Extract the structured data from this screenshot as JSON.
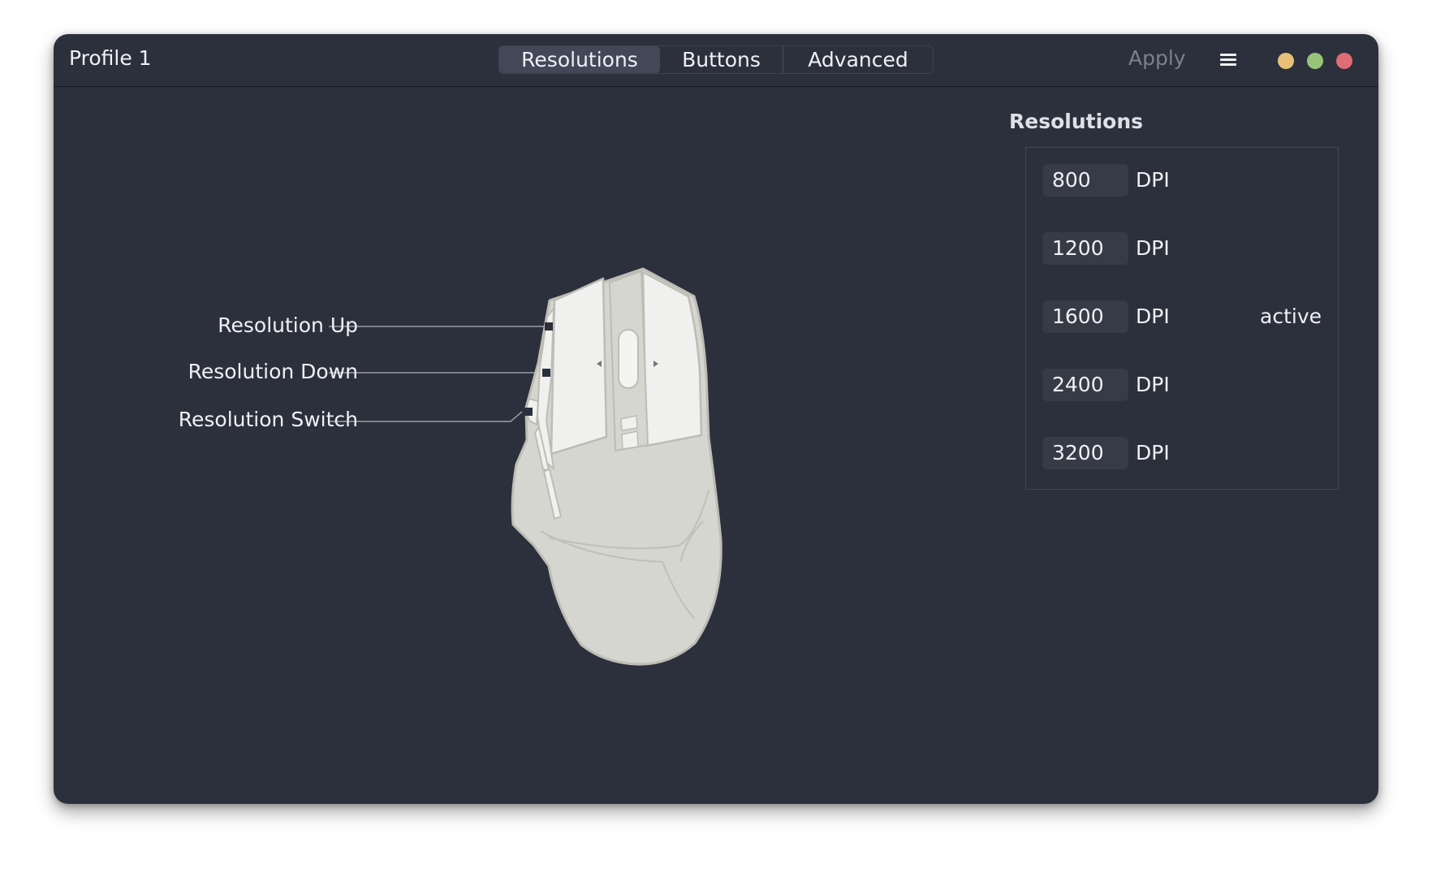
{
  "window": {
    "title": "Profile 1",
    "tabs": [
      {
        "label": "Resolutions",
        "active": true
      },
      {
        "label": "Buttons",
        "active": false
      },
      {
        "label": "Advanced",
        "active": false
      }
    ],
    "apply_label": "Apply",
    "menu_icon": "hamburger-menu-icon",
    "traffic_lights": [
      {
        "name": "minimize",
        "color": "#e7c07a"
      },
      {
        "name": "maximize",
        "color": "#98c379"
      },
      {
        "name": "close",
        "color": "#e06c75"
      }
    ]
  },
  "device": {
    "callouts": [
      {
        "label": "Resolution Up"
      },
      {
        "label": "Resolution Down"
      },
      {
        "label": "Resolution Switch"
      }
    ]
  },
  "resolutions": {
    "heading": "Resolutions",
    "items": [
      {
        "value": "800",
        "unit": "DPI",
        "status": ""
      },
      {
        "value": "1200",
        "unit": "DPI",
        "status": ""
      },
      {
        "value": "1600",
        "unit": "DPI",
        "status": "active"
      },
      {
        "value": "2400",
        "unit": "DPI",
        "status": ""
      },
      {
        "value": "3200",
        "unit": "DPI",
        "status": ""
      }
    ]
  },
  "colors": {
    "window_bg": "#2c303c",
    "text": "#eef0f5",
    "muted_text": "#7b808c",
    "mouse_body": "#d6d6d0",
    "mouse_highlight": "#f0f0ee"
  }
}
